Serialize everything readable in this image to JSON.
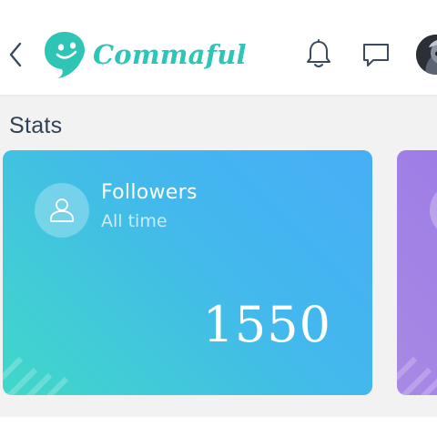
{
  "header": {
    "brand_name": "Commaful",
    "icons": {
      "back": "chevron-left-icon",
      "logo": "comma-bubble-logo",
      "notifications": "bell-icon",
      "messages": "chat-bubble-icon",
      "profile": "avatar"
    }
  },
  "stats": {
    "title": "Stats",
    "cards": [
      {
        "title": "Followers",
        "subtitle": "All time",
        "value": "1550",
        "icon": "user-icon"
      }
    ]
  },
  "colors": {
    "brand": "#2ec4b6",
    "title_text": "#2f4256",
    "followers_card_start": "#40d8c8",
    "followers_card_end": "#47aef6",
    "next_card": "#9b7be6",
    "background": "#f2f2f2"
  }
}
